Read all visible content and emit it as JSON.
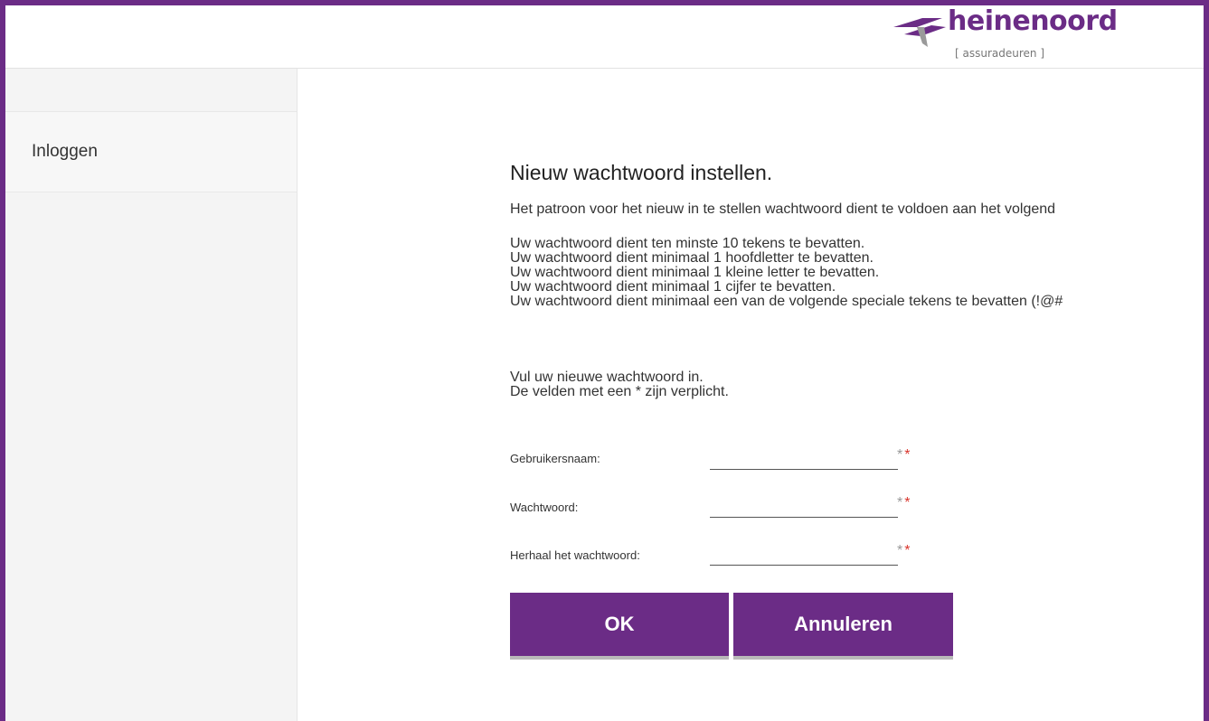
{
  "brand": {
    "name": "heinenoord",
    "tagline": "[ assuradeuren ]",
    "accent_color": "#6b2c86"
  },
  "sidebar": {
    "items": [
      {
        "label": "Inloggen"
      }
    ]
  },
  "main": {
    "title": "Nieuw wachtwoord instellen.",
    "intro": "Het patroon voor het nieuw in te stellen wachtwoord dient te voldoen aan het volgend",
    "rules": [
      "Uw wachtwoord dient ten minste 10 tekens te bevatten.",
      "Uw wachtwoord dient minimaal 1 hoofdletter te bevatten.",
      "Uw wachtwoord dient minimaal 1 kleine letter te bevatten.",
      "Uw wachtwoord dient minimaal 1 cijfer te bevatten.",
      "Uw wachtwoord dient minimaal een van de volgende speciale tekens te bevatten (!@#"
    ],
    "instructions": [
      "Vul uw nieuwe wachtwoord in.",
      "De velden met een * zijn verplicht."
    ]
  },
  "form": {
    "fields": [
      {
        "label": "Gebruikersnaam:",
        "value": "",
        "required_mark": "**"
      },
      {
        "label": "Wachtwoord:",
        "value": "",
        "required_mark": "**"
      },
      {
        "label": "Herhaal het wachtwoord:",
        "value": "",
        "required_mark": "**"
      }
    ],
    "ok_label": "OK",
    "cancel_label": "Annuleren"
  }
}
